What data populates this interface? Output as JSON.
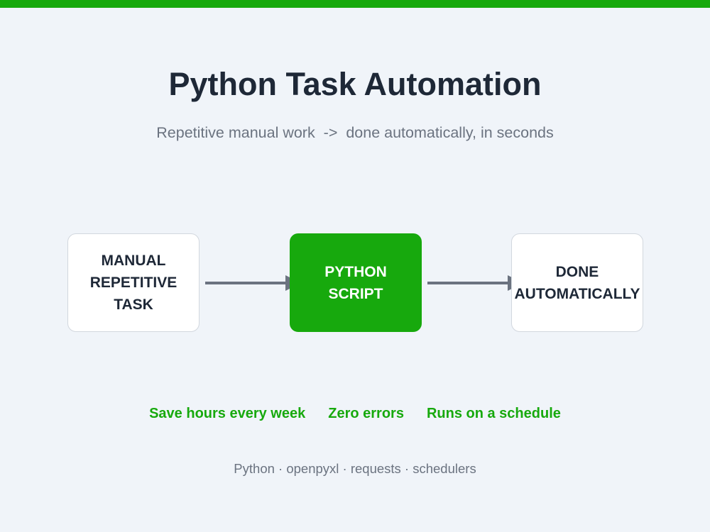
{
  "header": {
    "title": "Python Task Automation",
    "subtitle": "Repetitive manual work  ->  done automatically, in seconds"
  },
  "flow": {
    "steps": [
      {
        "lines": [
          "MANUAL",
          "REPETITIVE",
          "TASK"
        ]
      },
      {
        "lines": [
          "PYTHON",
          "SCRIPT"
        ]
      },
      {
        "lines": [
          "DONE",
          "AUTOMATICALLY"
        ]
      }
    ]
  },
  "benefits": [
    "Save hours every week",
    "Zero errors",
    "Runs on a schedule"
  ],
  "tech_stack": "Python · openpyxl · requests · schedulers",
  "colors": {
    "accent": "#17a90d",
    "title": "#1e2837",
    "muted": "#6b7380",
    "background": "#f0f4f9",
    "arrow": "#6b7380"
  }
}
